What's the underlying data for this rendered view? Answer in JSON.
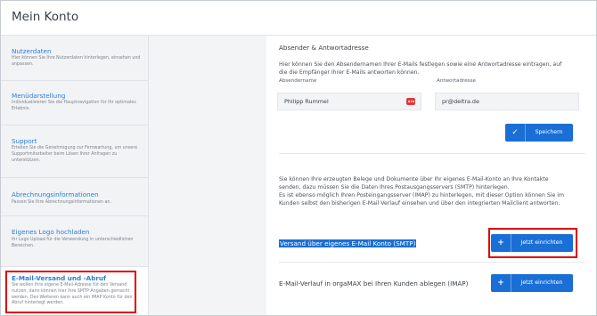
{
  "header": {
    "title": "Mein Konto"
  },
  "sidebar": {
    "items": [
      {
        "title": "Nutzerdaten",
        "desc": "Hier können Sie Ihre Nutzerdaten hinterlegen, einsehen und anpassen."
      },
      {
        "title": "Menüdarstellung",
        "desc": "Individualisieren Sie die Hauptnavigation für Ihr optimales Erlebnis."
      },
      {
        "title": "Support",
        "desc": "Erteilen Sie die Genehmigung zur Fernwartung, um unsere Supportmitarbeiter beim Lösen Ihrer Anfragen zu unterstützen."
      },
      {
        "title": "Abrechnungsinformationen",
        "desc": "Passen Sie Ihre Abrechnungsinformationen an."
      },
      {
        "title": "Eigenes Logo hochladen",
        "desc": "Ihr Logo Upload für die Verwendung in unterschiedlichen Bereichen."
      },
      {
        "title": "E-Mail-Versand und -Abruf",
        "desc": "Sie wollen Ihre eigene E-Mail-Adresse für den Versand nutzen, dann können hier Ihre SMTP Angaben gemacht werden. Des Weiteren kann auch ein IMAP Konto für den Abruf hinterlegt werden."
      }
    ]
  },
  "main": {
    "section_title": "Absender & Antwortadresse",
    "intro_line1": "Hier können Sie den Absendernamen Ihrer E-Mails festlegen sowie eine Antwortadresse eintragen, auf",
    "intro_line2": "die die Empfänger Ihrer E-Mails antworten können.",
    "sender_label": "Absendername",
    "sender_value": "Philipp Rummel",
    "reply_label": "Antwortadresse",
    "reply_value": "pr@deltra.de",
    "save_label": "Speichern",
    "info_line1": "Sie können Ihre erzeugten Belege und Dokumente über Ihr eigenes E-Mail-Konto an Ihre Kontakte",
    "info_line2": "senden, dazu müssen Sie die Daten Ihres Postausgangsservers (SMTP) hinterlegen.",
    "info_line3": "Es ist ebenso möglich Ihren Posteingangsserver (IMAP) zu hinterlegen, mit dieser Option können Sie im",
    "info_line4": "Kunden selbst den bisherigen E-Mail Verlauf einsehen und über den integrierten Mailclient antworten.",
    "smtp_label": "Versand über eigenes E-Mail Konto (SMTP)",
    "smtp_button": "Jetzt einrichten",
    "imap_label": "E-Mail-Verlauf in orgaMAX bei Ihren Kunden ablegen (IMAP)",
    "imap_button": "Jetzt einrichten"
  },
  "colors": {
    "accent": "#1a6fd6",
    "link": "#2d7dd2",
    "highlight": "#e00000"
  }
}
